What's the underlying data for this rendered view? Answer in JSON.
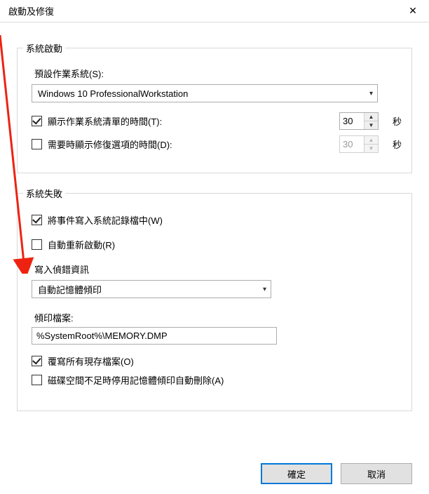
{
  "window": {
    "title": "啟動及修復",
    "close_icon": "✕"
  },
  "startup": {
    "group_title": "系統啟動",
    "default_os_label": "預設作業系統(S):",
    "default_os_value": "Windows 10 ProfessionalWorkstation",
    "show_list": {
      "checked": true,
      "label": "顯示作業系統清單的時間(T):",
      "value": "30",
      "unit": "秒"
    },
    "show_recovery": {
      "checked": false,
      "label": "需要時顯示修復選項的時間(D):",
      "value": "30",
      "unit": "秒"
    }
  },
  "failure": {
    "group_title": "系統失敗",
    "write_log": {
      "checked": true,
      "label": "將事件寫入系統記錄檔中(W)"
    },
    "auto_restart": {
      "checked": false,
      "label": "自動重新啟動(R)"
    },
    "debug_section_label": "寫入偵錯資訊",
    "debug_type_value": "自動記憶體傾印",
    "dump_file_label": "傾印檔案:",
    "dump_file_value": "%SystemRoot%\\MEMORY.DMP",
    "overwrite": {
      "checked": true,
      "label": "覆寫所有現存檔案(O)"
    },
    "low_disk": {
      "checked": false,
      "label": "磁碟空間不足時停用記憶體傾印自動刪除(A)"
    }
  },
  "buttons": {
    "ok": "確定",
    "cancel": "取消"
  }
}
